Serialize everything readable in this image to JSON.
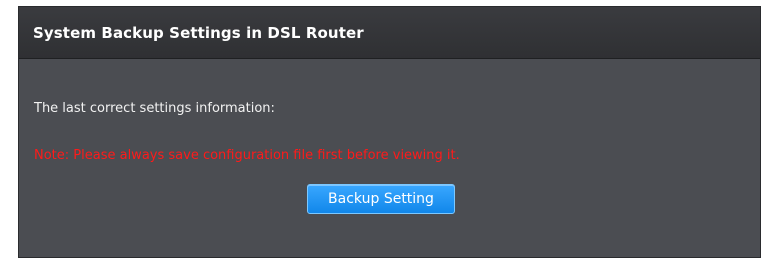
{
  "panel": {
    "title": "System Backup Settings in DSL Router"
  },
  "content": {
    "info_text": "The last correct settings information:",
    "note_text": "Note: Please always save configuration file first before viewing it.",
    "backup_button_label": "Backup Setting"
  },
  "colors": {
    "panel_bg": "#4b4d52",
    "header_bg": "#2f3033",
    "note_red": "#ff1a1a",
    "button_blue": "#1f95f3"
  }
}
